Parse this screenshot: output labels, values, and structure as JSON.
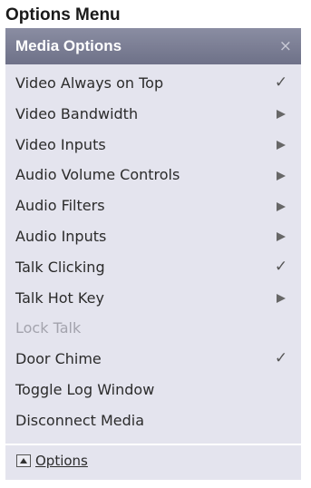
{
  "heading": "Options Menu",
  "panel": {
    "title": "Media Options",
    "close_glyph": "×"
  },
  "menu": [
    {
      "label": "Video Always on Top",
      "indicator": "check",
      "disabled": false
    },
    {
      "label": "Video Bandwidth",
      "indicator": "submenu-arrow",
      "disabled": false
    },
    {
      "label": "Video Inputs",
      "indicator": "submenu-arrow",
      "disabled": false
    },
    {
      "label": "Audio Volume Controls",
      "indicator": "submenu-arrow",
      "disabled": false
    },
    {
      "label": "Audio Filters",
      "indicator": "submenu-arrow",
      "disabled": false
    },
    {
      "label": "Audio Inputs",
      "indicator": "submenu-arrow",
      "disabled": false
    },
    {
      "label": "Talk Clicking",
      "indicator": "check",
      "disabled": false
    },
    {
      "label": "Talk Hot Key",
      "indicator": "submenu-arrow",
      "disabled": false
    },
    {
      "label": "Lock Talk",
      "indicator": "none",
      "disabled": true
    },
    {
      "label": "Door Chime",
      "indicator": "check",
      "disabled": false
    },
    {
      "label": "Toggle Log Window",
      "indicator": "none",
      "disabled": false
    },
    {
      "label": "Disconnect Media",
      "indicator": "none",
      "disabled": false
    }
  ],
  "footer": {
    "label": "Options",
    "icon": "collapse-up-icon"
  },
  "colors": {
    "titlebar": "#7a7d93",
    "panel_bg": "#e4e4ee",
    "text": "#2b2b2b",
    "disabled_text": "#a3a3ad"
  }
}
